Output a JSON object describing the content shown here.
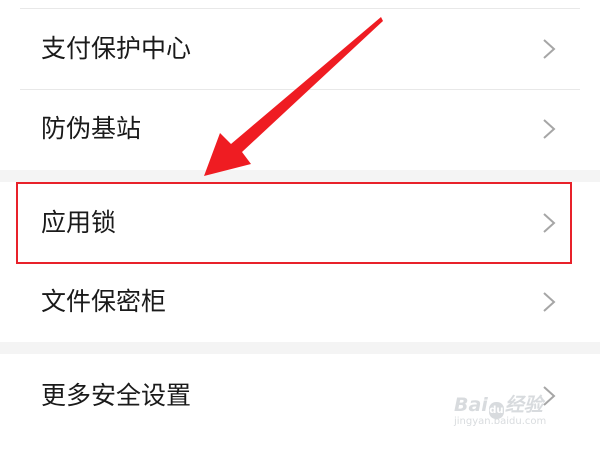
{
  "settings_list": {
    "items": [
      {
        "label": "支付保护中心"
      },
      {
        "label": "防伪基站"
      },
      {
        "label": "应用锁"
      },
      {
        "label": "文件保密柜"
      },
      {
        "label": "更多安全设置"
      }
    ]
  },
  "annotation": {
    "highlight_color": "#e8212a",
    "arrow_color": "#ef1c22",
    "highlighted_item": "应用锁"
  },
  "watermark": {
    "logo_text": "Bai du 经验",
    "site": "jingyan.baidu.com"
  },
  "icons": {
    "row_chevron": "chevron-right-icon",
    "annotation_arrow": "red-arrow-icon"
  }
}
